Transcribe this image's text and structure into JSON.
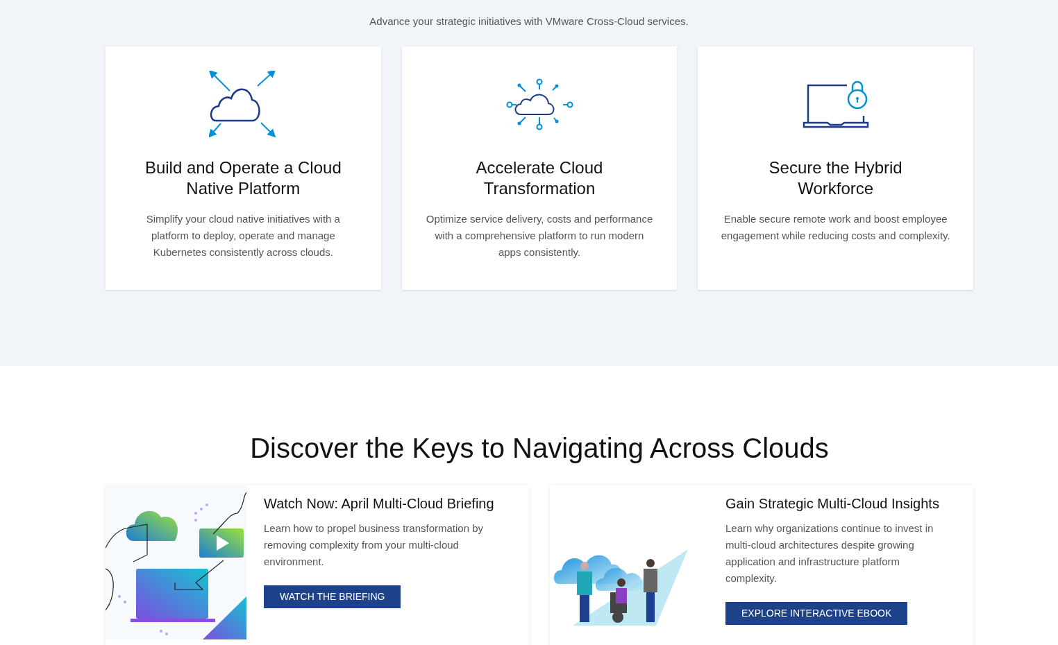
{
  "intro": {
    "text": "Advance your strategic initiatives with VMware Cross-Cloud services."
  },
  "solutions": [
    {
      "kind": "cloud-arrows",
      "title": "Build and Operate a Cloud Native Platform",
      "description": "Simplify your cloud native initiatives with a platform to deploy, operate and manage Kubernetes consistently across clouds."
    },
    {
      "kind": "cloud-nodes",
      "title": "Accelerate Cloud Transformation",
      "description": "Optimize service delivery, costs and performance with a comprehensive platform to run modern apps consistently."
    },
    {
      "kind": "laptop-lock",
      "title": "Secure the Hybrid Workforce",
      "description": "Enable secure remote work and boost employee engagement while reducing costs and complexity."
    }
  ],
  "discover": {
    "heading": "Discover the Keys to Navigating Across Clouds",
    "resources": [
      {
        "kind": "video",
        "title": "Watch Now: April Multi-Cloud Briefing",
        "description": "Learn how to propel business transformation by removing complexity from your multi-cloud environment.",
        "button": "WATCH THE BRIEFING"
      },
      {
        "kind": "ebook",
        "title": "Gain Strategic Multi-Cloud Insights",
        "description": "Learn why organizations continue to invest in multi-cloud architectures despite growing application and infrastructure platform complexity.",
        "button": "EXPLORE INTERACTIVE EBOOK"
      }
    ]
  }
}
